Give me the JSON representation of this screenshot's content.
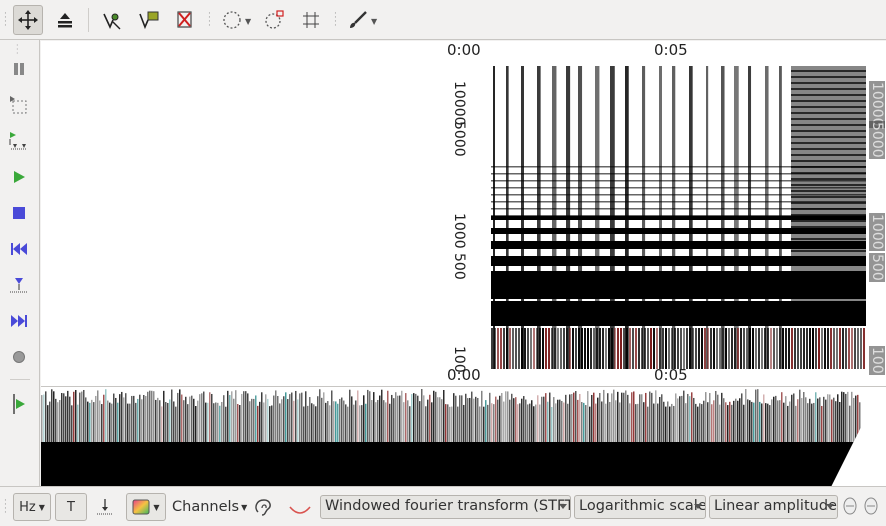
{
  "colors": {
    "toolbar_bg": "#f2f1f0",
    "pane_bg": "#ffffff",
    "accent_green": "#3aa83a",
    "accent_blue": "#4a4ad8",
    "accent_red": "#d02020"
  },
  "top_toolbar": {
    "icons": [
      "move-icon",
      "stack-icon",
      "select-point-icon",
      "comment-icon",
      "delete-marker-icon",
      "circle-select-icon",
      "circle-transform-icon",
      "grid-select-icon",
      "brush-icon"
    ]
  },
  "left_toolbar": {
    "icons": [
      "pause-icon",
      "select-region-icon",
      "loop-icon",
      "play-icon",
      "stop-icon",
      "rewind-icon",
      "set-position-icon",
      "fast-forward-icon",
      "record-icon",
      "play-selection-icon"
    ]
  },
  "spectrogram": {
    "time_axis": [
      "0:00",
      "0:05"
    ],
    "left_freq_labels": [
      "10000",
      "5000",
      "1000",
      "500",
      "100"
    ],
    "right_freq_labels": [
      "10000",
      "5000",
      "1000",
      "500",
      "100"
    ]
  },
  "bottom_toolbar": {
    "unit_button": "Hz",
    "time_button": "T",
    "channels_label": "Channels",
    "transform_select": "Windowed fourier transform (STFT)",
    "scale_select": "Logarithmic scale",
    "amplitude_select": "Linear amplitude"
  }
}
